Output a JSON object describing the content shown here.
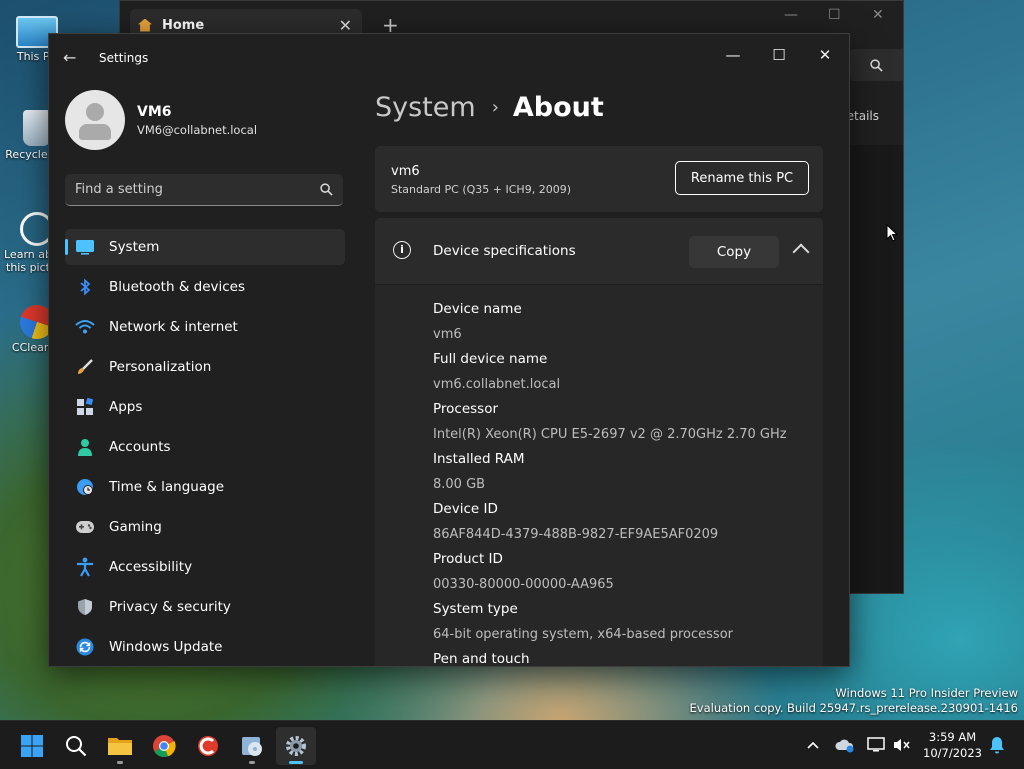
{
  "desktop": {
    "icons": [
      {
        "label": "This PC"
      },
      {
        "label": "Recycle Bin"
      },
      {
        "label": "Learn about this picture"
      },
      {
        "label": "CCleaner"
      }
    ],
    "watermark": {
      "line1": "Windows 11 Pro Insider Preview",
      "line2": "Evaluation copy. Build 25947.rs_prerelease.230901-1416"
    }
  },
  "explorer": {
    "tab_label": "Home",
    "details_label": "Details"
  },
  "settings": {
    "app_title": "Settings",
    "user": {
      "name": "VM6",
      "email": "VM6@collabnet.local"
    },
    "search": {
      "placeholder": "Find a setting",
      "value": ""
    },
    "nav": [
      {
        "label": "System",
        "icon": "monitor-icon",
        "active": true
      },
      {
        "label": "Bluetooth & devices",
        "icon": "bluetooth-icon"
      },
      {
        "label": "Network & internet",
        "icon": "wifi-icon"
      },
      {
        "label": "Personalization",
        "icon": "brush-icon"
      },
      {
        "label": "Apps",
        "icon": "apps-icon"
      },
      {
        "label": "Accounts",
        "icon": "person-icon"
      },
      {
        "label": "Time & language",
        "icon": "globe-clock-icon"
      },
      {
        "label": "Gaming",
        "icon": "gamepad-icon"
      },
      {
        "label": "Accessibility",
        "icon": "accessibility-icon"
      },
      {
        "label": "Privacy & security",
        "icon": "shield-icon"
      },
      {
        "label": "Windows Update",
        "icon": "update-icon"
      }
    ],
    "breadcrumb": {
      "parent": "System",
      "separator": "›",
      "current": "About"
    },
    "pc_card": {
      "name": "vm6",
      "model": "Standard PC (Q35 + ICH9, 2009)",
      "rename_label": "Rename this PC"
    },
    "specs": {
      "title": "Device specifications",
      "copy_label": "Copy",
      "items": [
        {
          "label": "Device name",
          "value": "vm6"
        },
        {
          "label": "Full device name",
          "value": "vm6.collabnet.local"
        },
        {
          "label": "Processor",
          "value": "Intel(R) Xeon(R) CPU E5-2697 v2 @ 2.70GHz   2.70 GHz"
        },
        {
          "label": "Installed RAM",
          "value": "8.00 GB"
        },
        {
          "label": "Device ID",
          "value": "86AF844D-4379-488B-9827-EF9AE5AF0209"
        },
        {
          "label": "Product ID",
          "value": "00330-80000-00000-AA965"
        },
        {
          "label": "System type",
          "value": "64-bit operating system, x64-based processor"
        },
        {
          "label": "Pen and touch",
          "value": ""
        }
      ]
    }
  },
  "taskbar": {
    "apps": [
      "start",
      "search",
      "file-explorer",
      "chrome",
      "ccleaner",
      "media-tool",
      "settings"
    ],
    "clock": {
      "time": "3:59 AM",
      "date": "10/7/2023"
    }
  },
  "colors": {
    "accent": "#4cc2ff",
    "window_bg": "#202020",
    "card_bg": "#2b2b2b"
  }
}
